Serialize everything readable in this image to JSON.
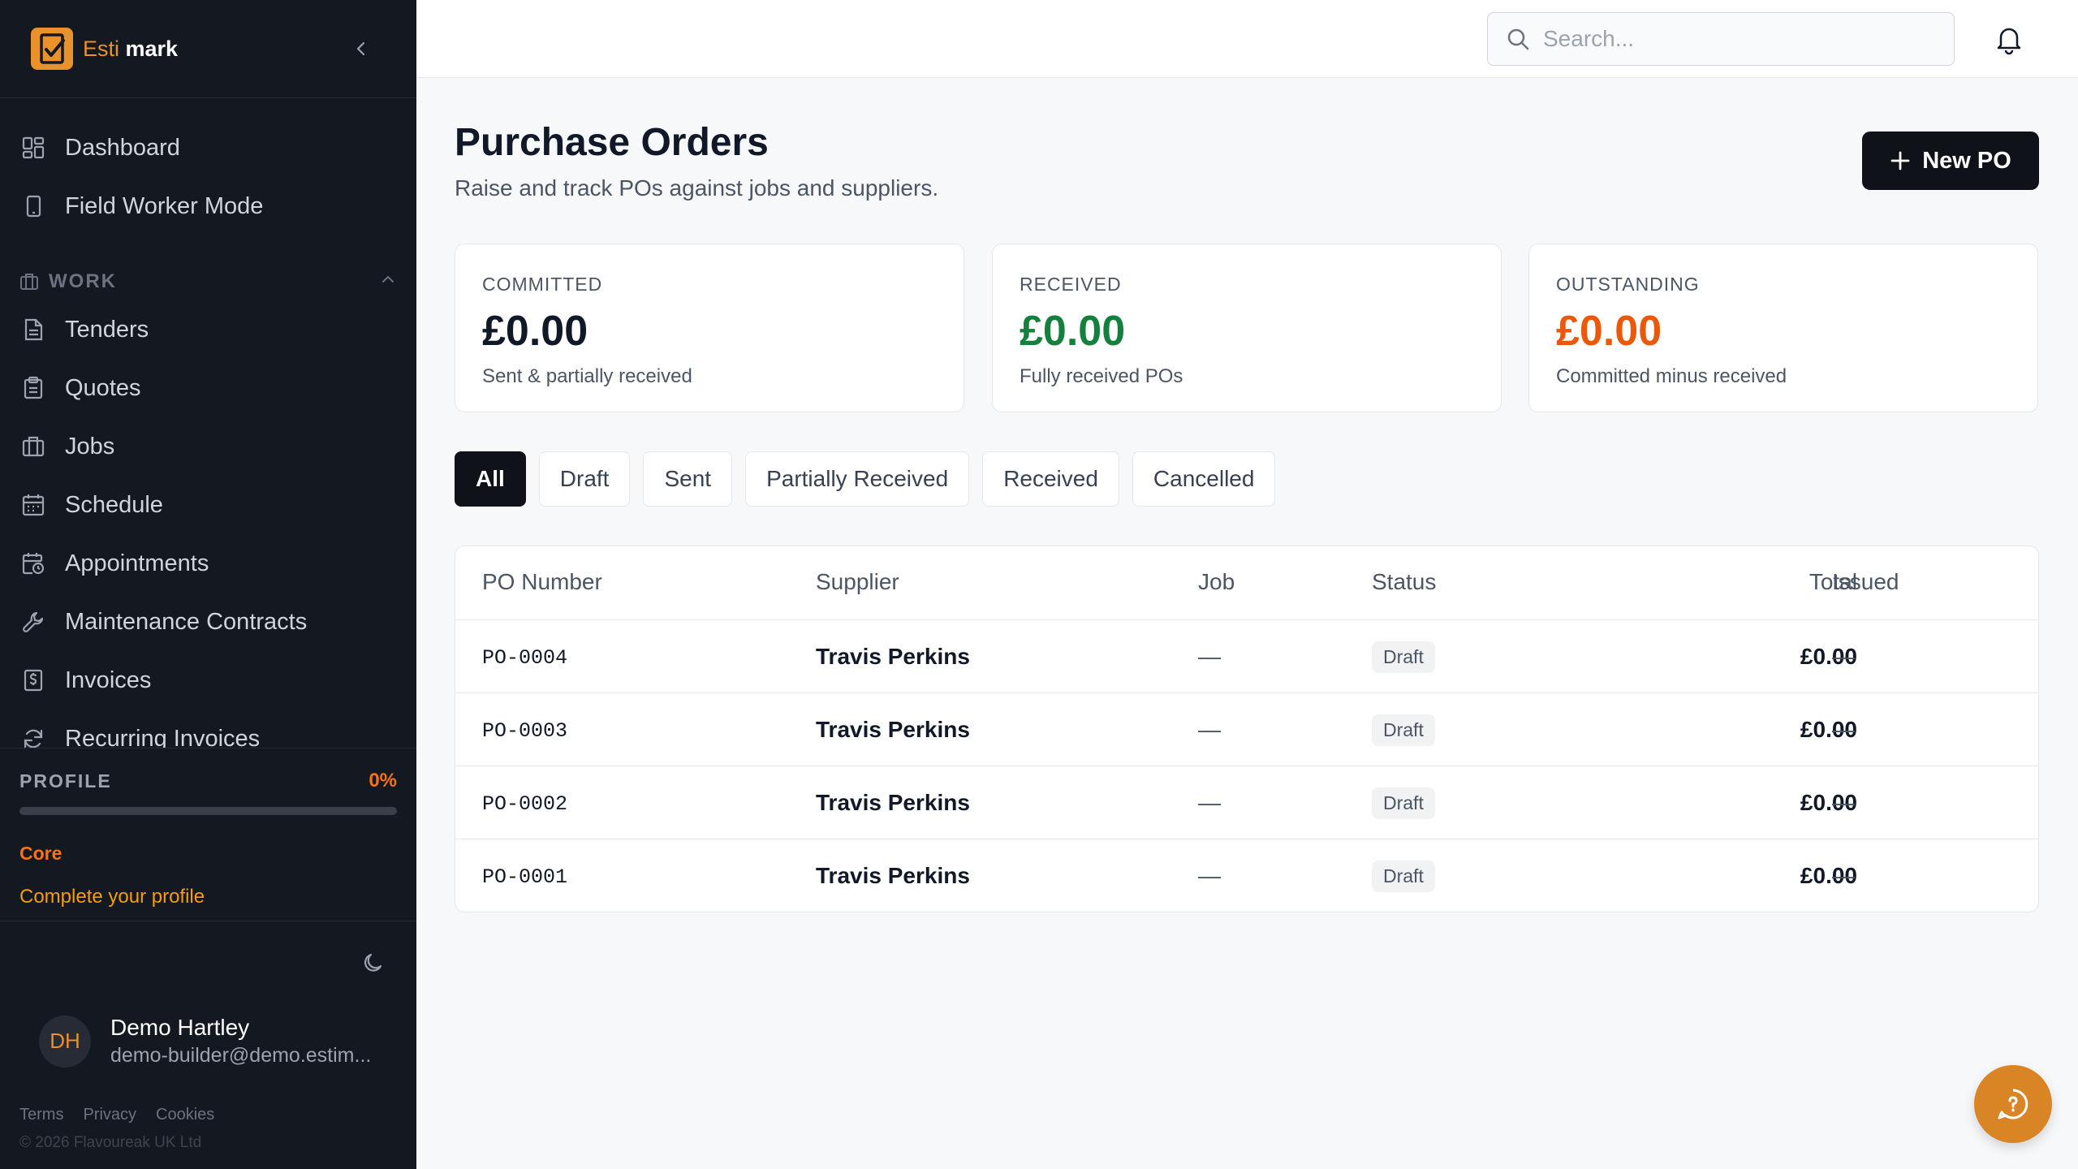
{
  "app": {
    "logo_left": "Esti",
    "logo_right": "mark"
  },
  "sidebar": {
    "items": [
      {
        "label": "Dashboard",
        "icon": "dashboard-icon"
      },
      {
        "label": "Field Worker Mode",
        "icon": "phone-icon"
      }
    ],
    "section": {
      "label": "WORK",
      "icon": "briefcase-icon"
    },
    "work_items": [
      {
        "label": "Tenders",
        "icon": "document-icon"
      },
      {
        "label": "Quotes",
        "icon": "clipboard-icon"
      },
      {
        "label": "Jobs",
        "icon": "briefcase-icon"
      },
      {
        "label": "Schedule",
        "icon": "calendar-icon"
      },
      {
        "label": "Appointments",
        "icon": "calendar-clock-icon"
      },
      {
        "label": "Maintenance Contracts",
        "icon": "wrench-icon"
      },
      {
        "label": "Invoices",
        "icon": "invoice-icon"
      },
      {
        "label": "Recurring Invoices",
        "icon": "refresh-icon"
      }
    ],
    "profile": {
      "label": "PROFILE",
      "percent": "0%",
      "progress_fraction": 0,
      "tier": "Core",
      "cta": "Complete your profile"
    },
    "user": {
      "initials": "DH",
      "name": "Demo Hartley",
      "email": "demo-builder@demo.estim..."
    },
    "footer": {
      "terms": "Terms",
      "privacy": "Privacy",
      "cookies": "Cookies",
      "copyright": "© 2026 Flavoureak UK Ltd"
    }
  },
  "topbar": {
    "search_placeholder": "Search..."
  },
  "page": {
    "title": "Purchase Orders",
    "subtitle": "Raise and track POs against jobs and suppliers.",
    "new_button": "New PO"
  },
  "cards": [
    {
      "label": "COMMITTED",
      "value": "£0.00",
      "caption": "Sent & partially received",
      "color": "#111827"
    },
    {
      "label": "RECEIVED",
      "value": "£0.00",
      "caption": "Fully received POs",
      "color": "#15803d"
    },
    {
      "label": "OUTSTANDING",
      "value": "£0.00",
      "caption": "Committed minus received",
      "color": "#ea580c"
    }
  ],
  "filters": [
    "All",
    "Draft",
    "Sent",
    "Partially Received",
    "Received",
    "Cancelled"
  ],
  "active_filter": "All",
  "table": {
    "headers": {
      "po": "PO Number",
      "supplier": "Supplier",
      "job": "Job",
      "status": "Status",
      "total": "Total",
      "issued": "Issued"
    },
    "rows": [
      {
        "po": "PO-0004",
        "supplier": "Travis Perkins",
        "job": "—",
        "status": "Draft",
        "total": "£0.00",
        "issued": "—"
      },
      {
        "po": "PO-0003",
        "supplier": "Travis Perkins",
        "job": "—",
        "status": "Draft",
        "total": "£0.00",
        "issued": "—"
      },
      {
        "po": "PO-0002",
        "supplier": "Travis Perkins",
        "job": "—",
        "status": "Draft",
        "total": "£0.00",
        "issued": "—"
      },
      {
        "po": "PO-0001",
        "supplier": "Travis Perkins",
        "job": "—",
        "status": "Draft",
        "total": "£0.00",
        "issued": "—"
      }
    ]
  },
  "colors": {
    "accent": "#e9912a",
    "sidebar_bg": "#141820",
    "primary_button": "#0f1218"
  }
}
